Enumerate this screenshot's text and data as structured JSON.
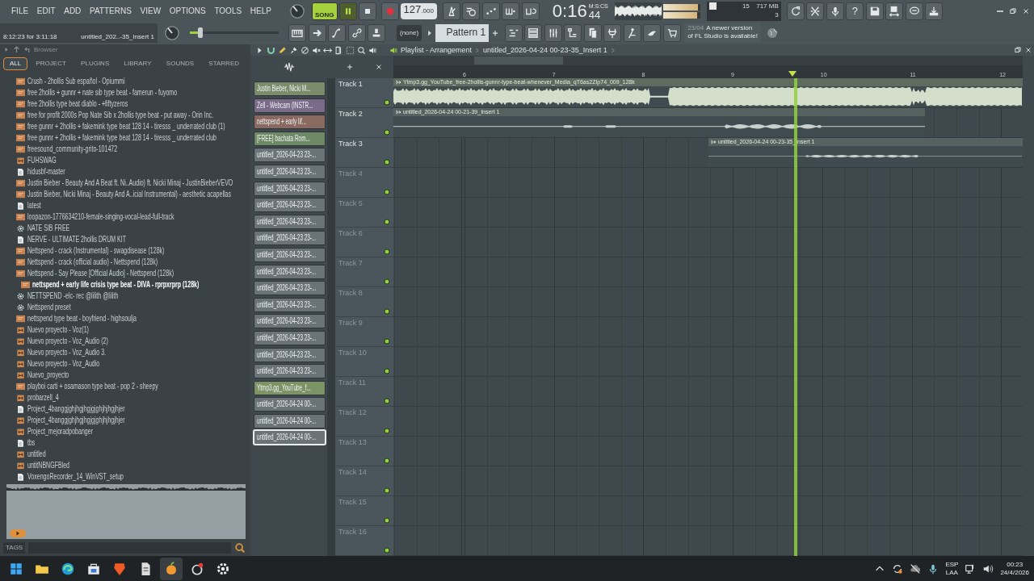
{
  "menu": [
    "FILE",
    "EDIT",
    "ADD",
    "PATTERNS",
    "VIEW",
    "OPTIONS",
    "TOOLS",
    "HELP"
  ],
  "transport": {
    "mode_label": "SONG",
    "song_mode": true,
    "playing": true,
    "tempo": "127",
    "tempo_fraction": ".000"
  },
  "clock": {
    "time": "0:16",
    "centiseconds": "44",
    "unit_label": "M:S:CS"
  },
  "master_meter": [
    {
      "level": 0.95
    },
    {
      "level": 0.92
    }
  ],
  "monitor": {
    "cpu": "15",
    "memory": "717 MB",
    "polyphony": "3"
  },
  "help_button": "?",
  "hint_bar": {
    "text": "8:12:23 for 3:11:18",
    "target": "untitled_202..-35_Insert 1"
  },
  "master_slider": {
    "level": 0.12
  },
  "pattern": {
    "arp": "(none)",
    "name": "Pattern 1"
  },
  "news": {
    "date": "23/04",
    "message": "A newer version of FL Studio is available!"
  },
  "browser": {
    "title": "Browser",
    "tabs": [
      {
        "label": "ALL",
        "selected": true
      },
      {
        "label": "PROJECT",
        "selected": false
      },
      {
        "label": "PLUGINS",
        "selected": false
      },
      {
        "label": "LIBRARY",
        "selected": false
      },
      {
        "label": "SOUNDS",
        "selected": false
      },
      {
        "label": "STARRED",
        "selected": false
      }
    ],
    "items": [
      {
        "label": "Crush - 2hollis  Sub español - Opiummi",
        "kind": "audio",
        "selected": false
      },
      {
        "label": "free 2hollis + gunnr + nate sib type beat - famerun - fuyomo",
        "kind": "audio",
        "selected": false
      },
      {
        "label": "free 2hollis type beat diablo - +fiftyzeros",
        "kind": "audio",
        "selected": false
      },
      {
        "label": "free for profit 2000s Pop Nate Sib x 2hollis type beat - put away - Orin Inc.",
        "kind": "audio",
        "selected": false
      },
      {
        "label": "free gunnr + 2hollis + fakemink type beat 128 14 - tiresss _ underrated club (1)",
        "kind": "audio",
        "selected": false
      },
      {
        "label": "free gunnr + 2hollis + fakemink type beat 128 14 - tiresss _ underrated club",
        "kind": "audio",
        "selected": false
      },
      {
        "label": "freesound_community-grito-101472",
        "kind": "audio",
        "selected": false
      },
      {
        "label": "FUHSWAG",
        "kind": "project",
        "selected": false
      },
      {
        "label": "hidusbf-master",
        "kind": "file",
        "selected": false
      },
      {
        "label": "Justin Bieber - Beauty And A Beat ft. Ni..Audio) ft. Nicki Minaj - JustinBieberVEVO",
        "kind": "audio",
        "selected": false
      },
      {
        "label": "Justin Bieber, Nicki Minaj - Beauty And A..icial Instrumental) - aesthetic acapellas",
        "kind": "audio",
        "selected": false
      },
      {
        "label": "latest",
        "kind": "file",
        "selected": false
      },
      {
        "label": "loopazon-1776634210-female-singing-vocal-lead-full-track",
        "kind": "audio",
        "selected": false
      },
      {
        "label": "NATE SIB FREE",
        "kind": "preset",
        "selected": false
      },
      {
        "label": "NERVE - ULTIMATE 2hollis DRUM KIT",
        "kind": "file",
        "selected": false
      },
      {
        "label": "Nettspend - crack (Instrumental) - swagdisease (128k)",
        "kind": "audio",
        "selected": false
      },
      {
        "label": "Nettspend - crack (official audio) - Nettspend (128k)",
        "kind": "audio",
        "selected": false
      },
      {
        "label": "Nettspend - Say Please [Official Audio] - Nettspend (128k)",
        "kind": "audio",
        "selected": false
      },
      {
        "label": "nettspend + early life crisis type beat - DIVA - rprpxrprp (128k)",
        "kind": "audio",
        "selected": true
      },
      {
        "label": "NETTSPEND -elc- rec @lilith @lilith",
        "kind": "preset",
        "selected": false
      },
      {
        "label": "Nettspend preset",
        "kind": "preset",
        "selected": false
      },
      {
        "label": "nettspend type beat - boyfriend - highsoulja",
        "kind": "audio",
        "selected": false
      },
      {
        "label": "Nuevo proyecto - Voz(1)",
        "kind": "project",
        "selected": false
      },
      {
        "label": "Nuevo proyecto - Voz_Audio (2)",
        "kind": "project",
        "selected": false
      },
      {
        "label": "Nuevo proyecto - Voz_Audio 3.",
        "kind": "project",
        "selected": false
      },
      {
        "label": "Nuevo proyecto - Voz_Audio",
        "kind": "project",
        "selected": false
      },
      {
        "label": "Nuevo_proyecto",
        "kind": "project",
        "selected": false
      },
      {
        "label": "playboi carti + osamason type beat - pop 2 - sheepy",
        "kind": "audio",
        "selected": false
      },
      {
        "label": "probarzell_4",
        "kind": "project",
        "selected": false
      },
      {
        "label": "Project_4banggjghjhgjhgjgjghjhjhgjhjer",
        "kind": "file",
        "selected": false
      },
      {
        "label": "Project_4banggjghjhgjhgjgjghjhjhgjhjer",
        "kind": "project",
        "selected": false
      },
      {
        "label": "Project_mejoradpobanger",
        "kind": "project",
        "selected": false
      },
      {
        "label": "tbs",
        "kind": "file",
        "selected": false
      },
      {
        "label": "untitled",
        "kind": "project",
        "selected": false
      },
      {
        "label": "untitNBNGFBled",
        "kind": "project",
        "selected": false
      },
      {
        "label": "VoxengoRecorder_14_WinVST_setup",
        "kind": "file",
        "selected": false
      }
    ],
    "tags_label": "TAGS"
  },
  "picker": [
    {
      "label": "Justin Bieber, Nicki M...",
      "color": "#7b8c6c",
      "selected": false
    },
    {
      "label": "Zell - Webcam (INSTR...",
      "color": "#7a6c88",
      "selected": false
    },
    {
      "label": "nettspend + early lif...",
      "color": "#8a6a60",
      "selected": false
    },
    {
      "label": "[FREE] bachata Rom...",
      "color": "#6f8966",
      "selected": false
    },
    {
      "label": "untitled_2026-04-23 23-...",
      "color": "#6a7378",
      "selected": false
    },
    {
      "label": "untitled_2026-04-23 23-...",
      "color": "#6a7378",
      "selected": false
    },
    {
      "label": "untitled_2026-04-23 23-...",
      "color": "#6a7378",
      "selected": false
    },
    {
      "label": "untitled_2026-04-23 23-...",
      "color": "#6a7378",
      "selected": false
    },
    {
      "label": "untitled_2026-04-23 23-...",
      "color": "#6a7378",
      "selected": false
    },
    {
      "label": "untitled_2026-04-23 23-...",
      "color": "#6a7378",
      "selected": false
    },
    {
      "label": "untitled_2026-04-23 23-...",
      "color": "#6a7378",
      "selected": false
    },
    {
      "label": "untitled_2026-04-23 23-...",
      "color": "#6a7378",
      "selected": false
    },
    {
      "label": "untitled_2026-04-23 23-...",
      "color": "#6a7378",
      "selected": false
    },
    {
      "label": "untitled_2026-04-23 23-...",
      "color": "#6a7378",
      "selected": false
    },
    {
      "label": "untitled_2026-04-23 23-...",
      "color": "#6a7378",
      "selected": false
    },
    {
      "label": "untitled_2026-04-23 23-...",
      "color": "#6a7378",
      "selected": false
    },
    {
      "label": "untitled_2026-04-23 23-...",
      "color": "#6a7378",
      "selected": false
    },
    {
      "label": "untitled_2026-04-23 23-...",
      "color": "#6a7378",
      "selected": false
    },
    {
      "label": "Ytmp3.gg_YouTube_f...",
      "color": "#7c9366",
      "selected": false
    },
    {
      "label": "untitled_2026-04-24 00-...",
      "color": "#6a7378",
      "selected": false
    },
    {
      "label": "untitled_2026-04-24 00-...",
      "color": "#6a7378",
      "selected": false
    },
    {
      "label": "untitled_2026-04-24 00-...",
      "color": "#6a7378",
      "selected": true
    }
  ],
  "playlist": {
    "title": "Playlist - Arrangement",
    "breadcrumb": "untitled_2026-04-24 00-23-35_Insert 1",
    "ruler": [
      "6",
      "7",
      "8",
      "9",
      "10",
      "11",
      "12"
    ],
    "tracks": [
      {
        "label": "Track 1",
        "dimmed": false,
        "clips": [
          {
            "title": "Ytmp3.gg_YouTube_free-2hollis-gunnr-type-beat-whenever_Media_qT6as2ZIp74_009_128k"
          }
        ]
      },
      {
        "label": "Track 2",
        "dimmed": false,
        "clips": [
          {
            "title": "untitled_2026-04-24 00-21-39_Insert 1"
          }
        ]
      },
      {
        "label": "Track 3",
        "dimmed": false,
        "clips": [
          {
            "title": "untitled_2026-04-24 00-23-35_Insert 1"
          }
        ]
      },
      {
        "label": "Track 4",
        "dimmed": true
      },
      {
        "label": "Track 5",
        "dimmed": true
      },
      {
        "label": "Track 6",
        "dimmed": true
      },
      {
        "label": "Track 7",
        "dimmed": true
      },
      {
        "label": "Track 8",
        "dimmed": true
      },
      {
        "label": "Track 9",
        "dimmed": true
      },
      {
        "label": "Track 10",
        "dimmed": true
      },
      {
        "label": "Track 11",
        "dimmed": true
      },
      {
        "label": "Track 12",
        "dimmed": true
      },
      {
        "label": "Track 13",
        "dimmed": true
      },
      {
        "label": "Track 14",
        "dimmed": true
      },
      {
        "label": "Track 15",
        "dimmed": true
      },
      {
        "label": "Track 16",
        "dimmed": true
      }
    ]
  },
  "taskbar": {
    "language": "ESP",
    "layout": "LAA",
    "time": "00:23",
    "date": "24/4/2026"
  }
}
